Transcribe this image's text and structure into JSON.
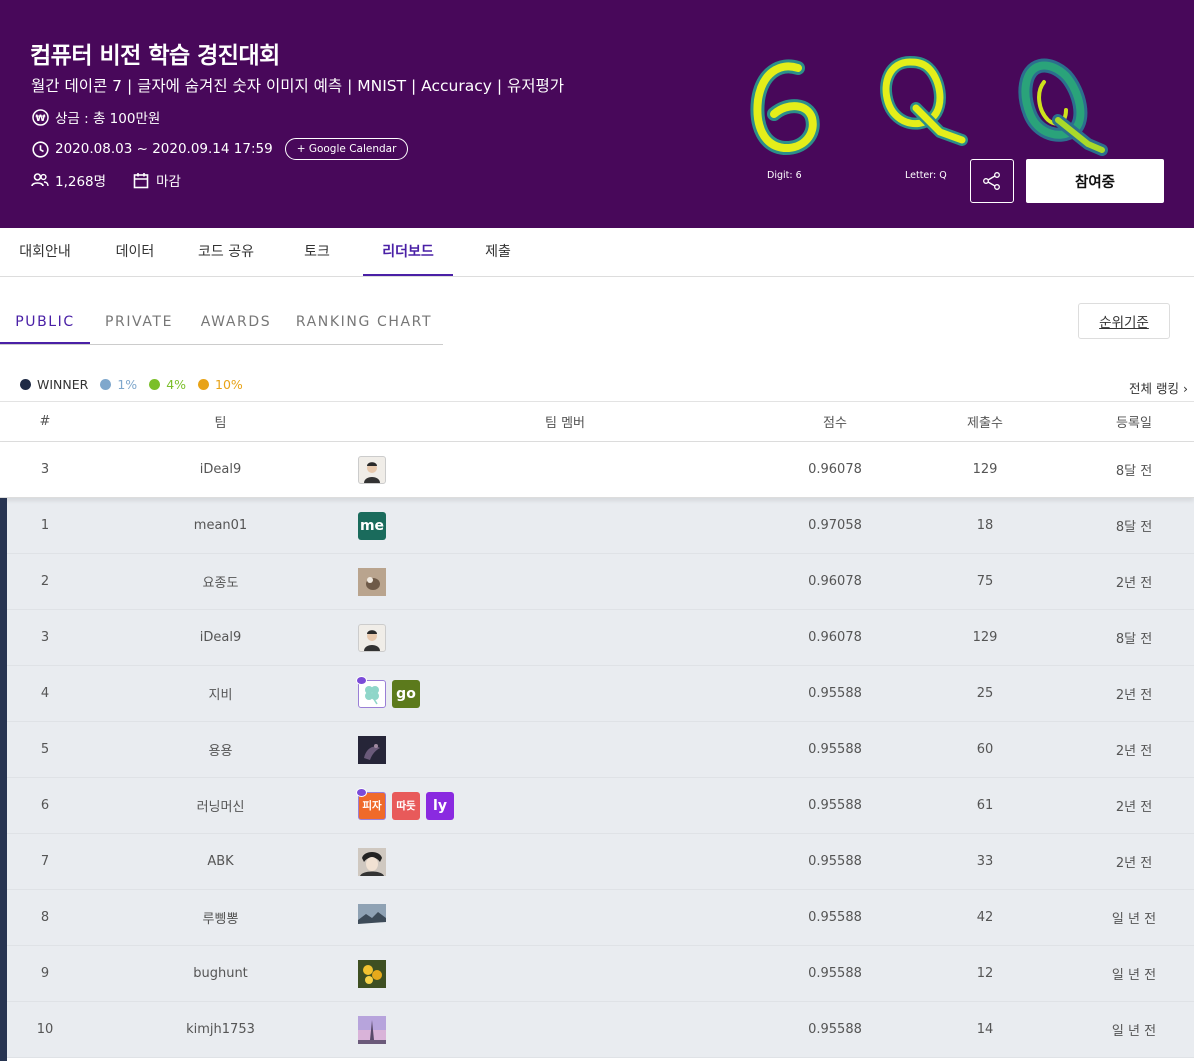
{
  "header": {
    "title": "컴퓨터 비전 학습 경진대회",
    "subtitle": "월간 데이콘 7 | 글자에 숨겨진 숫자 이미지 예측 | MNIST | Accuracy | 유저평가",
    "prize": "상금 : 총 100만원",
    "period": "2020.08.03 ~ 2020.09.14 17:59",
    "google_calendar": "+ Google Calendar",
    "participants": "1,268명",
    "status": "마감",
    "caption_digit": "Digit: 6",
    "caption_letter": "Letter: Q",
    "join_label": "참여중"
  },
  "main_tabs": [
    "대회안내",
    "데이터",
    "코드 공유",
    "토크",
    "리더보드",
    "제출"
  ],
  "sub_tabs": [
    "PUBLIC",
    "PRIVATE",
    "AWARDS",
    "RANKING CHART"
  ],
  "rank_basis": "순위기준",
  "legend": [
    {
      "label": "WINNER",
      "color": "#1f2b45"
    },
    {
      "label": "1%",
      "color": "#7fa7cc"
    },
    {
      "label": "4%",
      "color": "#7bbf2a"
    },
    {
      "label": "10%",
      "color": "#e8a317"
    }
  ],
  "all_ranking": "전체 랭킹 ›",
  "table_headers": {
    "num": "#",
    "team": "팀",
    "members": "팀 멤버",
    "score": "점수",
    "subs": "제출수",
    "date": "등록일"
  },
  "my_row": {
    "num": "3",
    "team": "iDeal9",
    "score": "0.96078",
    "subs": "129",
    "date": "8달 전"
  },
  "rows": [
    {
      "num": "1",
      "team": "mean01",
      "score": "0.97058",
      "subs": "18",
      "date": "8달 전"
    },
    {
      "num": "2",
      "team": "요종도",
      "score": "0.96078",
      "subs": "75",
      "date": "2년 전"
    },
    {
      "num": "3",
      "team": "iDeal9",
      "score": "0.96078",
      "subs": "129",
      "date": "8달 전"
    },
    {
      "num": "4",
      "team": "지비",
      "score": "0.95588",
      "subs": "25",
      "date": "2년 전"
    },
    {
      "num": "5",
      "team": "용용",
      "score": "0.95588",
      "subs": "60",
      "date": "2년 전"
    },
    {
      "num": "6",
      "team": "러닝머신",
      "score": "0.95588",
      "subs": "61",
      "date": "2년 전"
    },
    {
      "num": "7",
      "team": "ABK",
      "score": "0.95588",
      "subs": "33",
      "date": "2년 전"
    },
    {
      "num": "8",
      "team": "루삥뽕",
      "score": "0.95588",
      "subs": "42",
      "date": "일 년 전"
    },
    {
      "num": "9",
      "team": "bughunt",
      "score": "0.95588",
      "subs": "12",
      "date": "일 년 전"
    },
    {
      "num": "10",
      "team": "kimjh1753",
      "score": "0.95588",
      "subs": "14",
      "date": "일 년 전"
    }
  ],
  "avatars": {
    "me": "me",
    "go": "go",
    "pizza": "피자",
    "ttatteut": "따듯",
    "ly": "ly"
  }
}
